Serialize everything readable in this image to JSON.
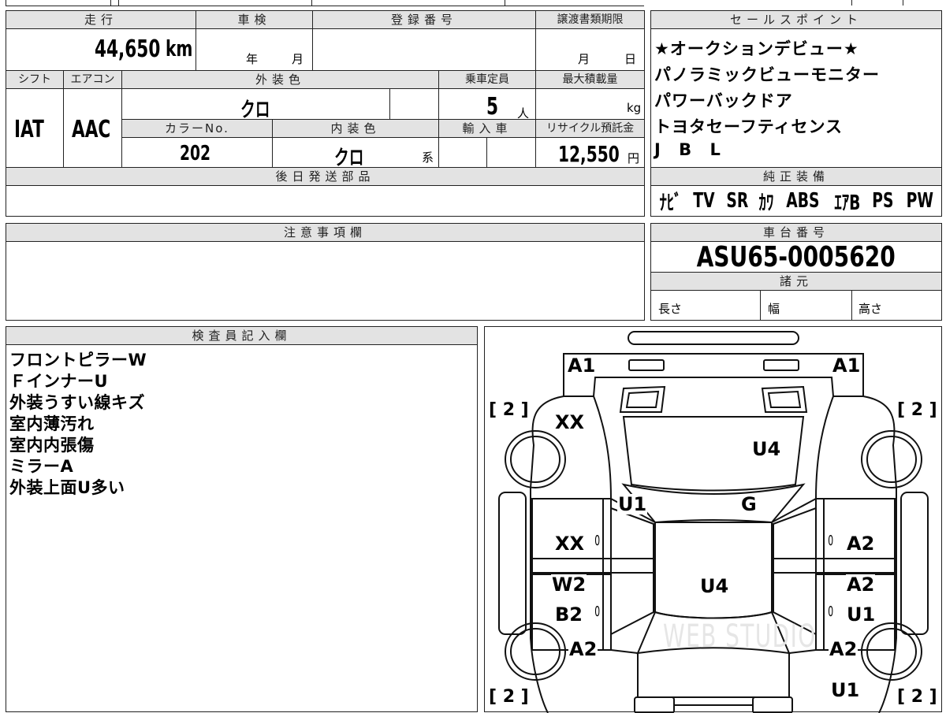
{
  "top_info": {
    "mileage_label": "走行",
    "mileage_value": "44,650",
    "mileage_unit": "km",
    "shaken_label": "車検",
    "shaken_year": "年",
    "shaken_month": "月",
    "registration_label": "登録番号",
    "transfer_deadline_label": "譲渡書類期限",
    "transfer_month": "月",
    "transfer_day": "日",
    "shift_label": "シフト",
    "shift_value": "IAT",
    "ac_label": "エアコン",
    "ac_value": "AAC",
    "exterior_color_label": "外装色",
    "exterior_color_value": "クロ",
    "capacity_label": "乗車定員",
    "capacity_value": "5",
    "capacity_unit": "人",
    "max_load_label": "最大積載量",
    "max_load_unit": "kg",
    "color_no_label": "カラーNo.",
    "color_no_value": "202",
    "interior_color_label": "内装色",
    "interior_color_value": "クロ",
    "interior_color_suffix": "系",
    "import_label": "輸入車",
    "recycle_label": "リサイクル預託金",
    "recycle_value": "12,550",
    "recycle_unit": "円",
    "later_parts_label": "後日発送部品"
  },
  "sales_points": {
    "title": "セールスポイント",
    "lines": [
      "★オークションデビュー★",
      "パノラミックビューモニター",
      "パワーバックドア",
      "トヨタセーフティセンス",
      "J B L"
    ]
  },
  "equipment": {
    "title": "純正装備",
    "items": [
      "ﾅﾋﾞ",
      "TV",
      "SR",
      "ｶﾜ",
      "ABS",
      "ｴｱB",
      "PS",
      "PW"
    ]
  },
  "notes": {
    "title": "注意事項欄"
  },
  "chassis": {
    "title": "車台番号",
    "value": "ASU65-0005620",
    "spec_title": "諸元",
    "length_label": "長さ",
    "width_label": "幅",
    "height_label": "高さ"
  },
  "inspector": {
    "title": "検査員記入欄",
    "lines": [
      "フロントピラーW",
      "ＦインナーU",
      "外装うすい線キズ",
      "室内薄汚れ",
      "室内内張傷",
      "ミラーA",
      "外装上面U多い"
    ]
  },
  "diagram": {
    "watermark": "WEB STUDIO",
    "marks": [
      {
        "id": "front-left-a1",
        "text": "A1"
      },
      {
        "id": "front-right-a1",
        "text": "A1"
      },
      {
        "id": "tyre-fl",
        "text": "[ 2 ]"
      },
      {
        "id": "tyre-fr",
        "text": "[ 2 ]"
      },
      {
        "id": "tyre-rl",
        "text": "[ 2 ]"
      },
      {
        "id": "tyre-rr",
        "text": "[ 2 ]"
      },
      {
        "id": "left-fender-xx",
        "text": "XX"
      },
      {
        "id": "hood-u4",
        "text": "U4"
      },
      {
        "id": "windshield-u1",
        "text": "U1"
      },
      {
        "id": "windshield-g",
        "text": "G"
      },
      {
        "id": "left-front-door-xx",
        "text": "XX"
      },
      {
        "id": "right-front-door-a2",
        "text": "A2"
      },
      {
        "id": "roof-u4",
        "text": "U4"
      },
      {
        "id": "left-rear-door-w2",
        "text": "W2"
      },
      {
        "id": "left-rear-door-b2",
        "text": "B2"
      },
      {
        "id": "right-rear-door-a2",
        "text": "A2"
      },
      {
        "id": "right-rear-door-u1",
        "text": "U1"
      },
      {
        "id": "left-rear-fender-a2",
        "text": "A2"
      },
      {
        "id": "right-rear-fender-a2",
        "text": "A2"
      },
      {
        "id": "right-rear-u1",
        "text": "U1"
      },
      {
        "id": "zero-1",
        "text": "0"
      },
      {
        "id": "zero-2",
        "text": "0"
      },
      {
        "id": "zero-3",
        "text": "0"
      },
      {
        "id": "zero-4",
        "text": "0"
      }
    ]
  }
}
